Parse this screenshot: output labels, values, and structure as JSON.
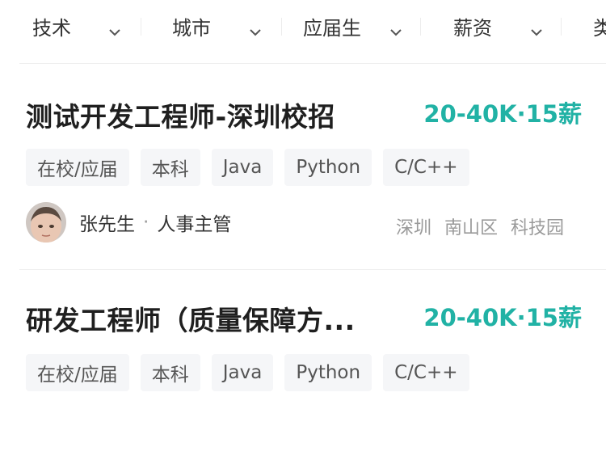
{
  "filters": [
    {
      "label": "技术"
    },
    {
      "label": "城市"
    },
    {
      "label": "应届生"
    },
    {
      "label": "薪资"
    },
    {
      "label": "类"
    }
  ],
  "jobs": [
    {
      "title": "测试开发工程师-深圳校招",
      "salary": "20-40K·15薪",
      "tags": [
        "在校/应届",
        "本科",
        "Java",
        "Python",
        "C/C++"
      ],
      "recruiter": {
        "name": "张先生",
        "separator": "·",
        "title": "人事主管"
      },
      "location": [
        "深圳",
        "南山区",
        "科技园"
      ]
    },
    {
      "title": "研发工程师（质量保障方...",
      "salary": "20-40K·15薪",
      "tags": [
        "在校/应届",
        "本科",
        "Java",
        "Python",
        "C/C++"
      ]
    }
  ],
  "colors": {
    "salary": "#21b2a5",
    "tag_bg": "#f5f6f8",
    "title": "#1f1f1f",
    "muted": "#9a9a9a"
  },
  "icons": {
    "filter_chevron": "chevron-down-icon",
    "avatar": "recruiter-avatar"
  }
}
